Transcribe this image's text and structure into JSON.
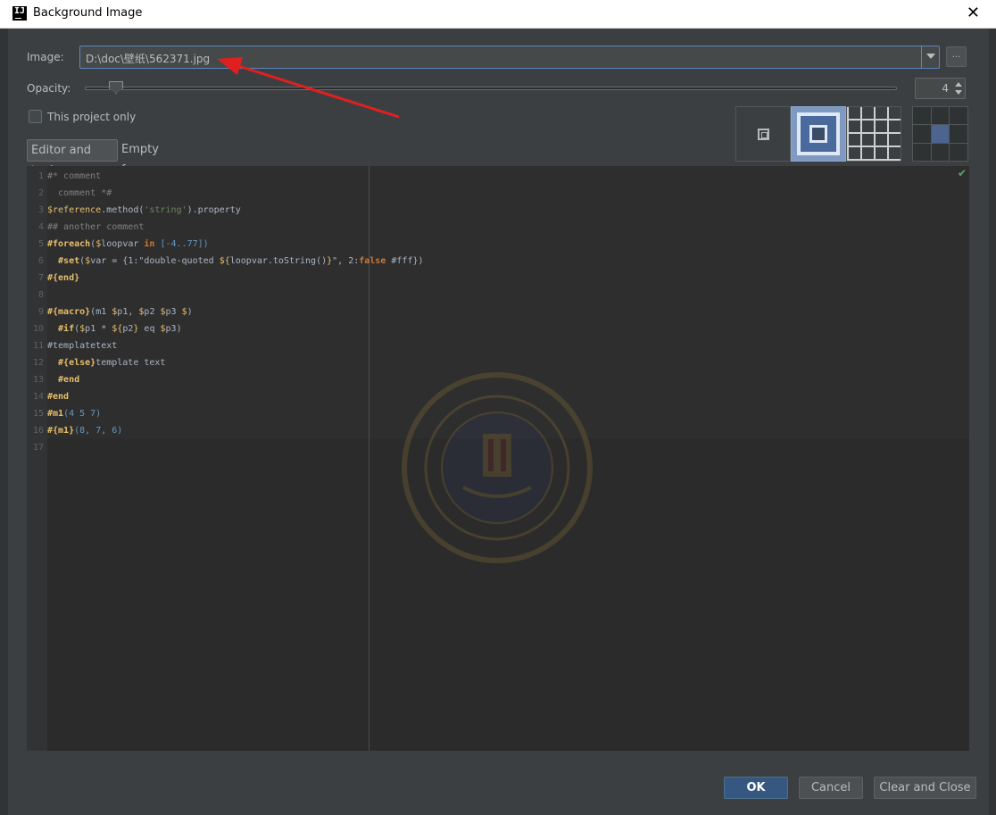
{
  "window": {
    "title": "Background Image"
  },
  "image_field": {
    "label": "Image:",
    "value": "D:\\doc\\壁纸\\562371.jpg",
    "browse_label": "..."
  },
  "opacity": {
    "label": "Opacity:",
    "value": "4",
    "slider_fraction": 0.04
  },
  "project_only": {
    "label": "This project only",
    "checked": false
  },
  "fill_modes": [
    "plain-icon",
    "scale-icon",
    "tile-icon"
  ],
  "anchor": {
    "selected_cell": 5
  },
  "tabs": [
    {
      "label": "Editor and tools",
      "active": true
    },
    {
      "label": "Empty frame",
      "active": false
    }
  ],
  "editor": {
    "line_numbers": [
      "1",
      "2",
      "3",
      "4",
      "5",
      "6",
      "7",
      "8",
      "9",
      "10",
      "11",
      "12",
      "13",
      "14",
      "15",
      "16",
      "17"
    ],
    "lines": [
      [
        {
          "t": "#* comment",
          "c": "cm"
        }
      ],
      [
        {
          "t": "  comment *#",
          "c": "cm"
        }
      ],
      [
        {
          "t": "$reference",
          "c": "var"
        },
        {
          "t": ".method(",
          "c": "plain"
        },
        {
          "t": "'string'",
          "c": "str"
        },
        {
          "t": ").property",
          "c": "plain"
        }
      ],
      [
        {
          "t": "## another comment",
          "c": "cm"
        }
      ],
      [
        {
          "t": "#foreach",
          "c": "dir"
        },
        {
          "t": "(",
          "c": "plain"
        },
        {
          "t": "$",
          "c": "var"
        },
        {
          "t": "loopvar ",
          "c": "plain"
        },
        {
          "t": "in",
          "c": "kw"
        },
        {
          "t": " [-4..77])",
          "c": "num"
        }
      ],
      [
        {
          "t": "  #set",
          "c": "dir"
        },
        {
          "t": "(",
          "c": "plain"
        },
        {
          "t": "$",
          "c": "var"
        },
        {
          "t": "var = {1:\"double-quoted ",
          "c": "plain"
        },
        {
          "t": "${",
          "c": "var"
        },
        {
          "t": "loopvar.toString()",
          "c": "plain"
        },
        {
          "t": "}",
          "c": "var"
        },
        {
          "t": "\", 2:",
          "c": "plain"
        },
        {
          "t": "false",
          "c": "kw"
        },
        {
          "t": " #fff})",
          "c": "plain"
        }
      ],
      [
        {
          "t": "#{end}",
          "c": "dir"
        }
      ],
      [],
      [
        {
          "t": "#{macro}",
          "c": "dir"
        },
        {
          "t": "(m1 ",
          "c": "plain"
        },
        {
          "t": "$",
          "c": "var"
        },
        {
          "t": "p1, ",
          "c": "plain"
        },
        {
          "t": "$",
          "c": "var"
        },
        {
          "t": "p2 ",
          "c": "plain"
        },
        {
          "t": "$",
          "c": "var"
        },
        {
          "t": "p3 ",
          "c": "plain"
        },
        {
          "t": "$",
          "c": "var"
        },
        {
          "t": ")",
          "c": "plain"
        }
      ],
      [
        {
          "t": "  #if",
          "c": "dir"
        },
        {
          "t": "(",
          "c": "plain"
        },
        {
          "t": "$",
          "c": "var"
        },
        {
          "t": "p1 * ",
          "c": "plain"
        },
        {
          "t": "${",
          "c": "var"
        },
        {
          "t": "p2",
          "c": "plain"
        },
        {
          "t": "}",
          "c": "var"
        },
        {
          "t": " eq ",
          "c": "plain"
        },
        {
          "t": "$",
          "c": "var"
        },
        {
          "t": "p3)",
          "c": "plain"
        }
      ],
      [
        {
          "t": "#templatetext",
          "c": "plain"
        }
      ],
      [
        {
          "t": "  #{else}",
          "c": "dir"
        },
        {
          "t": "template text",
          "c": "plain"
        }
      ],
      [
        {
          "t": "  #end",
          "c": "dir"
        }
      ],
      [
        {
          "t": "#end",
          "c": "dir"
        }
      ],
      [
        {
          "t": "#m1",
          "c": "dir"
        },
        {
          "t": "(4 5 7)",
          "c": "num"
        }
      ],
      [
        {
          "t": "#{m1}",
          "c": "dir"
        },
        {
          "t": "(8, 7, 6)",
          "c": "num"
        }
      ],
      []
    ]
  },
  "buttons": {
    "ok": "OK",
    "cancel": "Cancel",
    "clear_close": "Clear and Close"
  },
  "colors": {
    "accent": "#365880",
    "arrow": "#e02020",
    "background": "#3c3f41"
  }
}
